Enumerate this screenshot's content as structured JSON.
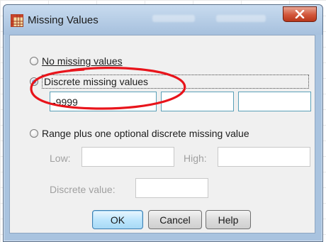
{
  "window": {
    "title": "Missing Values",
    "icon": "spss-grid-icon",
    "close_glyph": "x"
  },
  "options": {
    "no_missing": {
      "label": "No missing values",
      "checked": false
    },
    "discrete": {
      "label": "Discrete missing values",
      "checked": true
    },
    "range": {
      "label": "Range plus one optional discrete missing value",
      "checked": false
    }
  },
  "discrete_values": [
    "-9999",
    "",
    ""
  ],
  "range_fields": {
    "low_label": "Low:",
    "high_label": "High:",
    "discrete_value_label": "Discrete value:",
    "low_value": "",
    "high_value": "",
    "discrete_value": ""
  },
  "buttons": {
    "ok": "OK",
    "cancel": "Cancel",
    "help": "Help"
  },
  "colors": {
    "annotation": "#e8141b",
    "focus_border": "#5aa0b8",
    "close_button": "#c9432a"
  }
}
